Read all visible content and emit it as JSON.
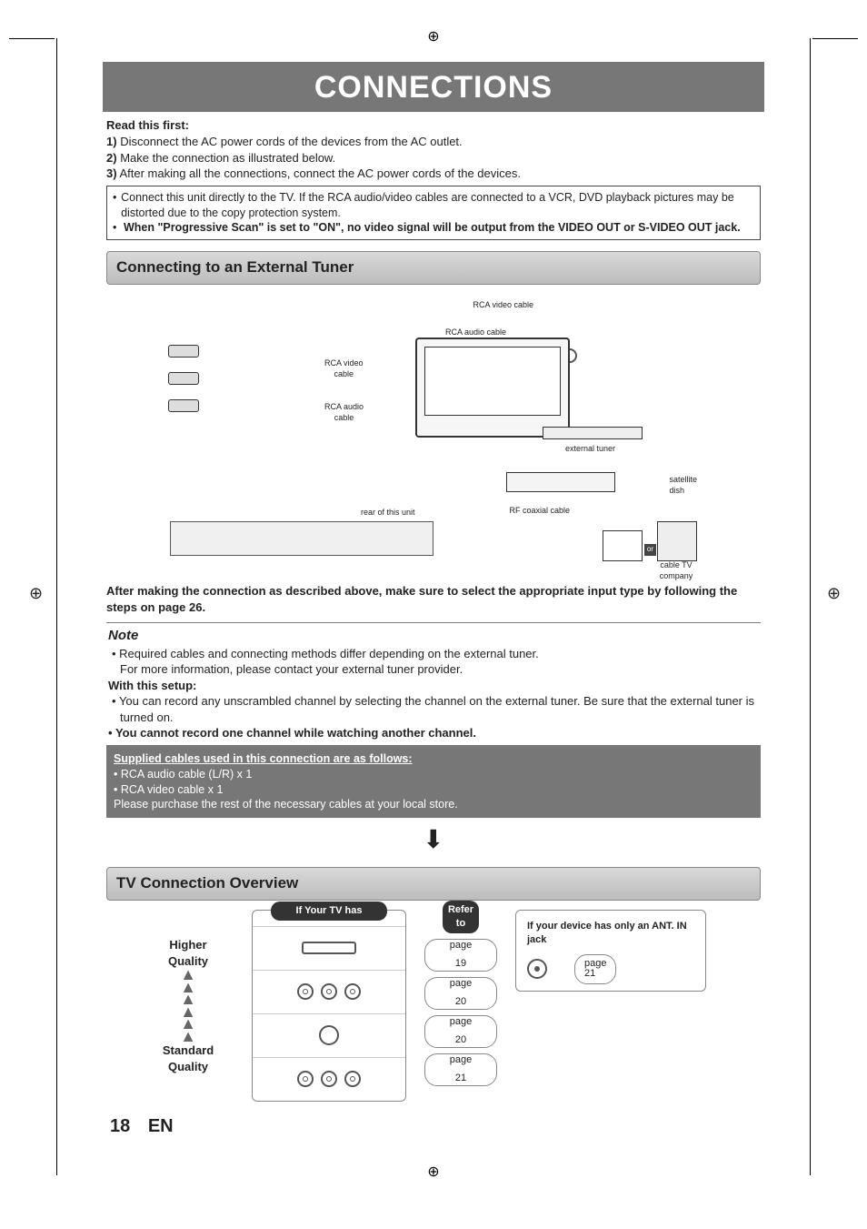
{
  "page_title": "CONNECTIONS",
  "read_first_heading": "Read this first:",
  "steps": {
    "s1_num": "1)",
    "s1": "Disconnect the AC power cords of the devices from the AC outlet.",
    "s2_num": "2)",
    "s2": "Make the connection as illustrated below.",
    "s3_num": "3)",
    "s3": "After making all the connections, connect the AC power cords of the devices."
  },
  "caution_box": {
    "b1": "Connect this unit directly to the TV. If the RCA audio/video cables are connected to a VCR, DVD playback pictures may be distorted due to the copy protection system.",
    "b2": "When \"Progressive Scan\" is set to \"ON\", no video signal will be output from the VIDEO OUT or S-VIDEO OUT jack."
  },
  "section_external": "Connecting to an External Tuner",
  "diagram": {
    "rca_video_top": "RCA video cable",
    "rca_audio_top": "RCA audio  cable",
    "rca_video_mid": "RCA video\ncable",
    "rca_audio_mid": "RCA audio\ncable",
    "rear_label": "rear of this unit",
    "external_tuner": "external tuner",
    "rf_coax": "RF coaxial cable",
    "satellite": "satellite\ndish",
    "or": "or",
    "cable_tv": "cable TV\ncompany"
  },
  "after_diagram": "After making the connection as described above, make sure to select the appropriate input type by following the steps on page 26.",
  "note": {
    "title": "Note",
    "b1": "Required cables and connecting methods differ depending on the external tuner.",
    "b1b": "For more information, please contact your external tuner provider.",
    "with_setup": "With this setup:",
    "b2": "You can record any unscrambled channel by selecting the channel on the external tuner. Be sure that the external tuner is turned on.",
    "b3": "You cannot record one channel while watching another channel."
  },
  "supplied": {
    "heading": "Supplied cables used in this connection are as follows:",
    "l1": "• RCA audio cable (L/R) x 1",
    "l2": "• RCA video cable x 1",
    "l3": "Please purchase the rest of the necessary cables at your local store."
  },
  "tv_overview": "TV Connection Overview",
  "overview": {
    "higher": "Higher\nQuality",
    "standard": "Standard\nQuality",
    "if_tv_has": "If Your TV has",
    "refer_to": "Refer to",
    "page": "page",
    "p19": "19",
    "p20a": "20",
    "p20b": "20",
    "p21": "21",
    "ant_heading": "If your device has only an ANT. IN jack",
    "ant_page": "21"
  },
  "footer": {
    "num": "18",
    "lang": "EN"
  }
}
